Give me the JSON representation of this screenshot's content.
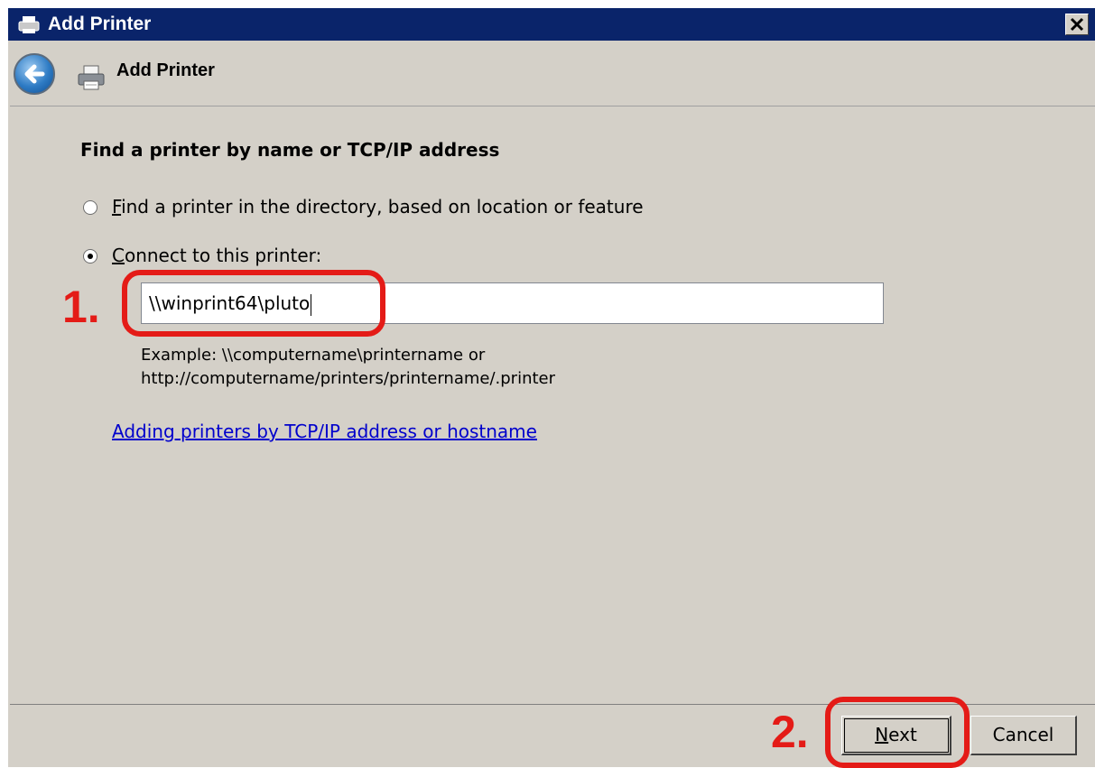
{
  "window": {
    "title": "Add Printer",
    "close_label": "✕"
  },
  "nav": {
    "title": "Add Printer"
  },
  "content": {
    "heading": "Find a printer by name or TCP/IP address",
    "option1": {
      "mnemonic": "F",
      "label_rest": "ind a printer in the directory, based on location or feature",
      "selected": false
    },
    "option2": {
      "mnemonic": "C",
      "label_rest": "onnect to this printer:",
      "selected": true
    },
    "printer_input_value": "\\\\winprint64\\pluto",
    "example_line1": "Example: \\\\computername\\printername or",
    "example_line2": "http://computername/printers/printername/.printer",
    "help_link": "Adding printers by TCP/IP address or hostname"
  },
  "annotations": {
    "step1": "1.",
    "step2": "2."
  },
  "buttons": {
    "next_mnemonic": "N",
    "next_rest": "ext",
    "cancel": "Cancel"
  },
  "colors": {
    "titlebar": "#0a246a",
    "dialog_bg": "#d4d0c8",
    "annotation_red": "#e41b17",
    "link": "#0000cc"
  }
}
